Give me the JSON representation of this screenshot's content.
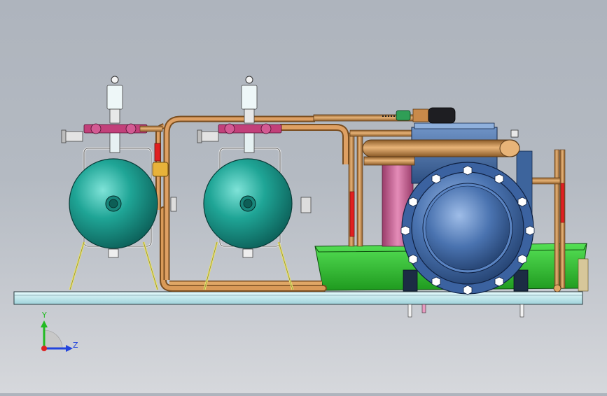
{
  "view": {
    "background_top": "#aeb4bd",
    "background_bottom": "#d6d8dc"
  },
  "model": {
    "receiver_color": "#1f9a8e",
    "pipe_color": "#c98a4a",
    "valve_color": "#c2407a",
    "tray_color": "#33cc33",
    "compressor_color": "#3e6aa8",
    "base_color": "#bfe8ee",
    "hot_pipe_color": "#e02020"
  },
  "triad": {
    "y_label": "Y",
    "z_label": "Z",
    "y_color": "#22bb22",
    "z_color": "#2244dd",
    "x_color": "#dd2222"
  }
}
